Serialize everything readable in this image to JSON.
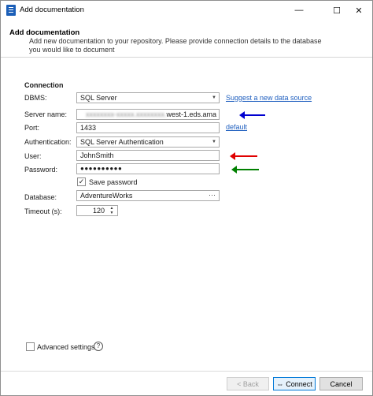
{
  "window": {
    "title": "Add documentation",
    "minimize_glyph": "—",
    "maximize_glyph": "☐",
    "close_glyph": "✕"
  },
  "header": {
    "title": "Add documentation",
    "description": "Add new documentation to your repository. Please provide connection details to the database you would like to document"
  },
  "connection": {
    "section_title": "Connection",
    "dbms_label": "DBMS:",
    "dbms_value": "SQL Server",
    "suggest_link": "Suggest a new data source",
    "server_label": "Server name:",
    "server_value_visible": "west-1.eds.ama",
    "port_label": "Port:",
    "port_value": "1433",
    "port_default_link": "default",
    "auth_label": "Authentication:",
    "auth_value": "SQL Server Authentication",
    "user_label": "User:",
    "user_value": "JohnSmith",
    "password_label": "Password:",
    "password_value": "●●●●●●●●●●",
    "save_password_label": "Save password",
    "save_password_checked": true,
    "database_label": "Database:",
    "database_value": "AdventureWorks",
    "database_browse": "···",
    "timeout_label": "Timeout (s):",
    "timeout_value": "120"
  },
  "annotations": {
    "server_arrow_color": "#0000d0",
    "user_arrow_color": "#e00000",
    "password_arrow_color": "#008000"
  },
  "advanced": {
    "label": "Advanced settings",
    "help": "?"
  },
  "footer": {
    "back_label": "< Back",
    "connect_label": "Connect",
    "connect_icon": "⇔",
    "cancel_label": "Cancel"
  }
}
